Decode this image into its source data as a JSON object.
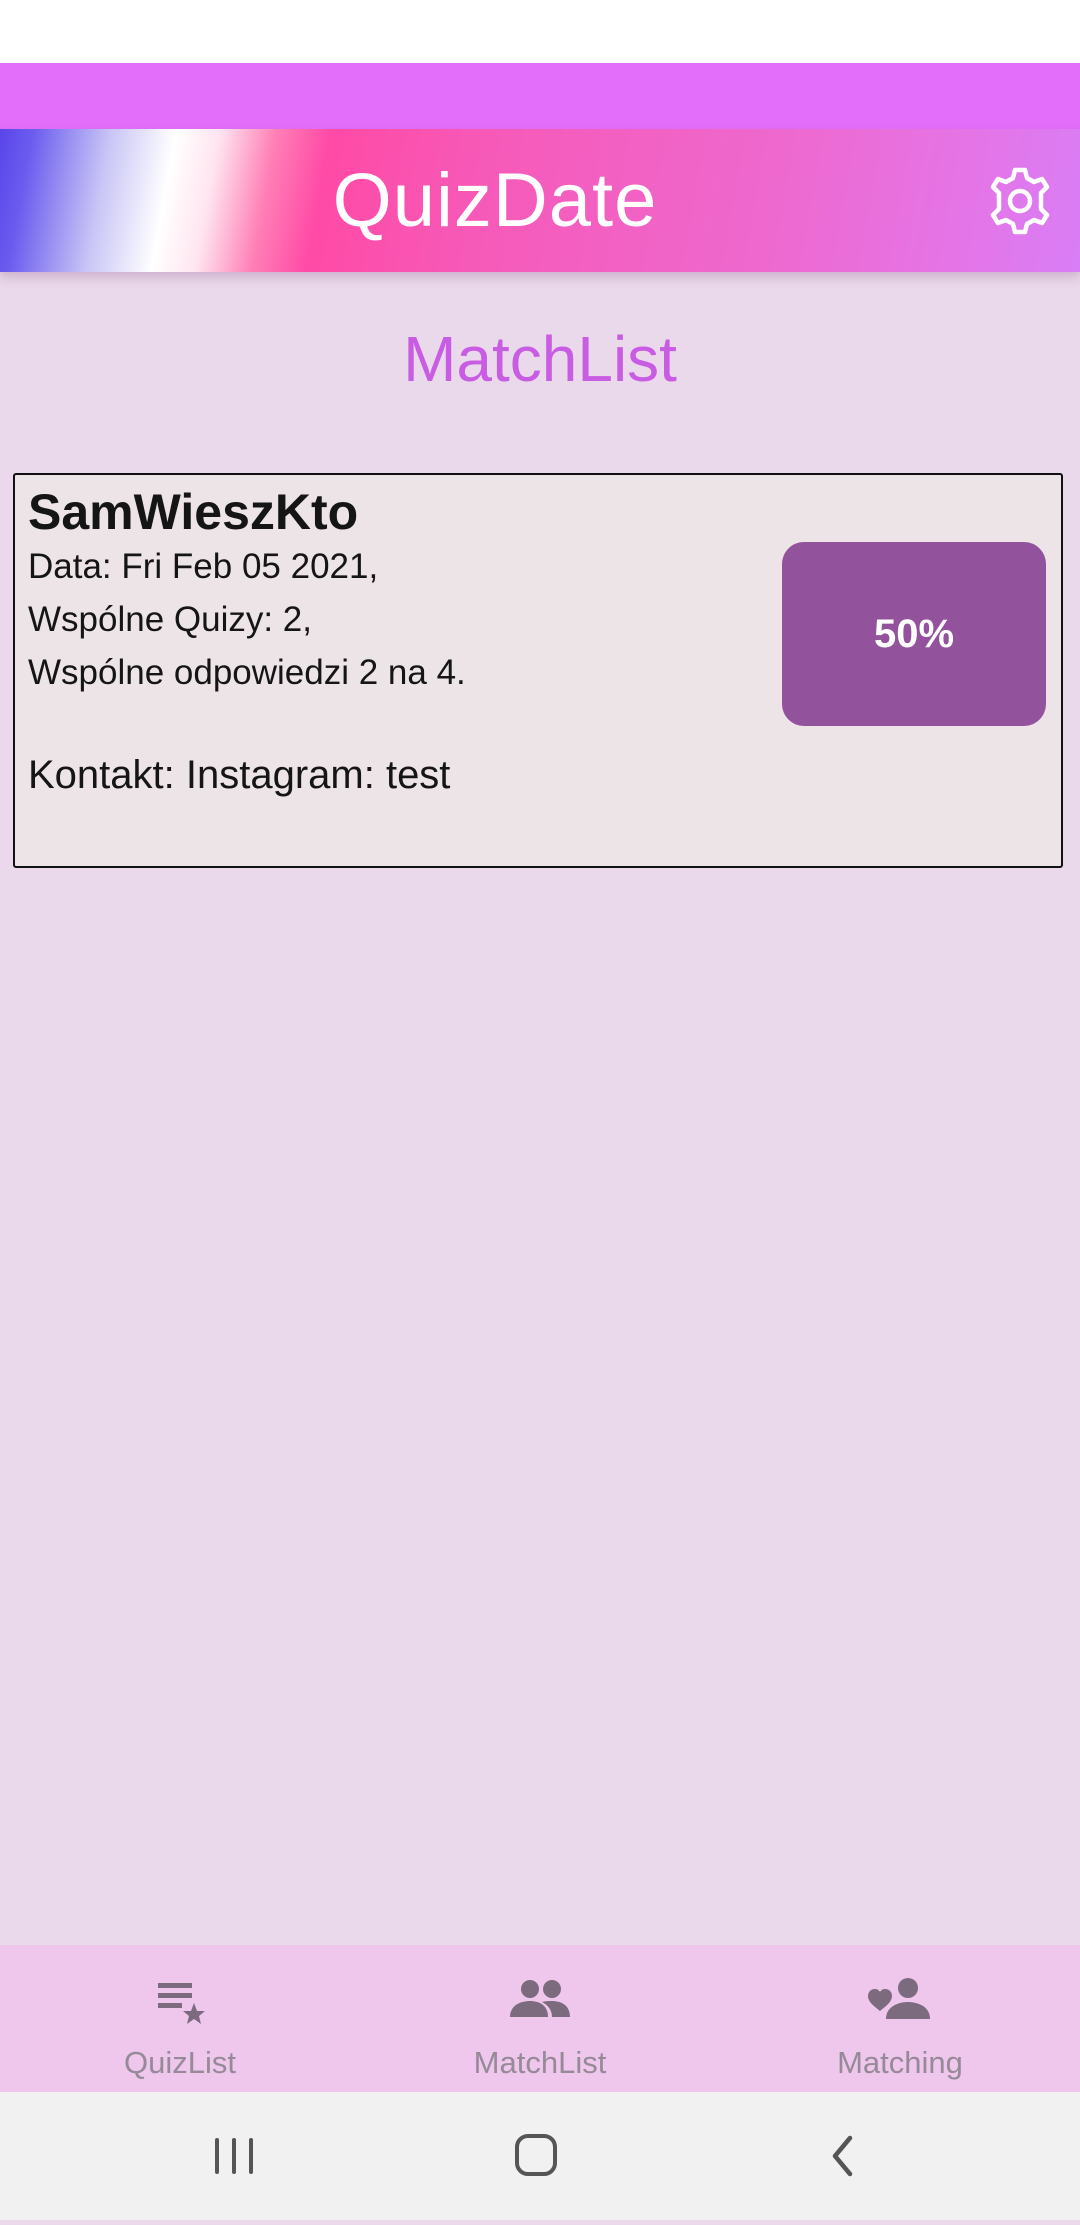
{
  "app_bar": {
    "title": "QuizDate",
    "settings_icon": "gear-icon"
  },
  "page": {
    "title": "MatchList"
  },
  "matches": [
    {
      "name": "SamWieszKto",
      "date_line": "Data: Fri Feb 05 2021,",
      "quizzes_line": "Wspólne Quizy: 2,",
      "answers_line": "Wspólne odpowiedzi 2 na 4.",
      "contact": "Kontakt: Instagram: test",
      "score": "50%"
    }
  ],
  "bottom_nav": {
    "items": [
      {
        "label": "QuizList",
        "icon": "playlist-star-icon"
      },
      {
        "label": "MatchList",
        "icon": "people-icon"
      },
      {
        "label": "Matching",
        "icon": "person-heart-icon"
      }
    ]
  },
  "system_nav": {
    "recents_icon": "recents-icon",
    "home_icon": "home-icon",
    "back_icon": "back-icon"
  },
  "colors": {
    "page_background": "#ead9ea",
    "accent_title": "#c85ce3",
    "score_badge": "#93529c",
    "bottom_nav_bg": "#efc6ec",
    "nav_icon": "#7c6b7e"
  }
}
